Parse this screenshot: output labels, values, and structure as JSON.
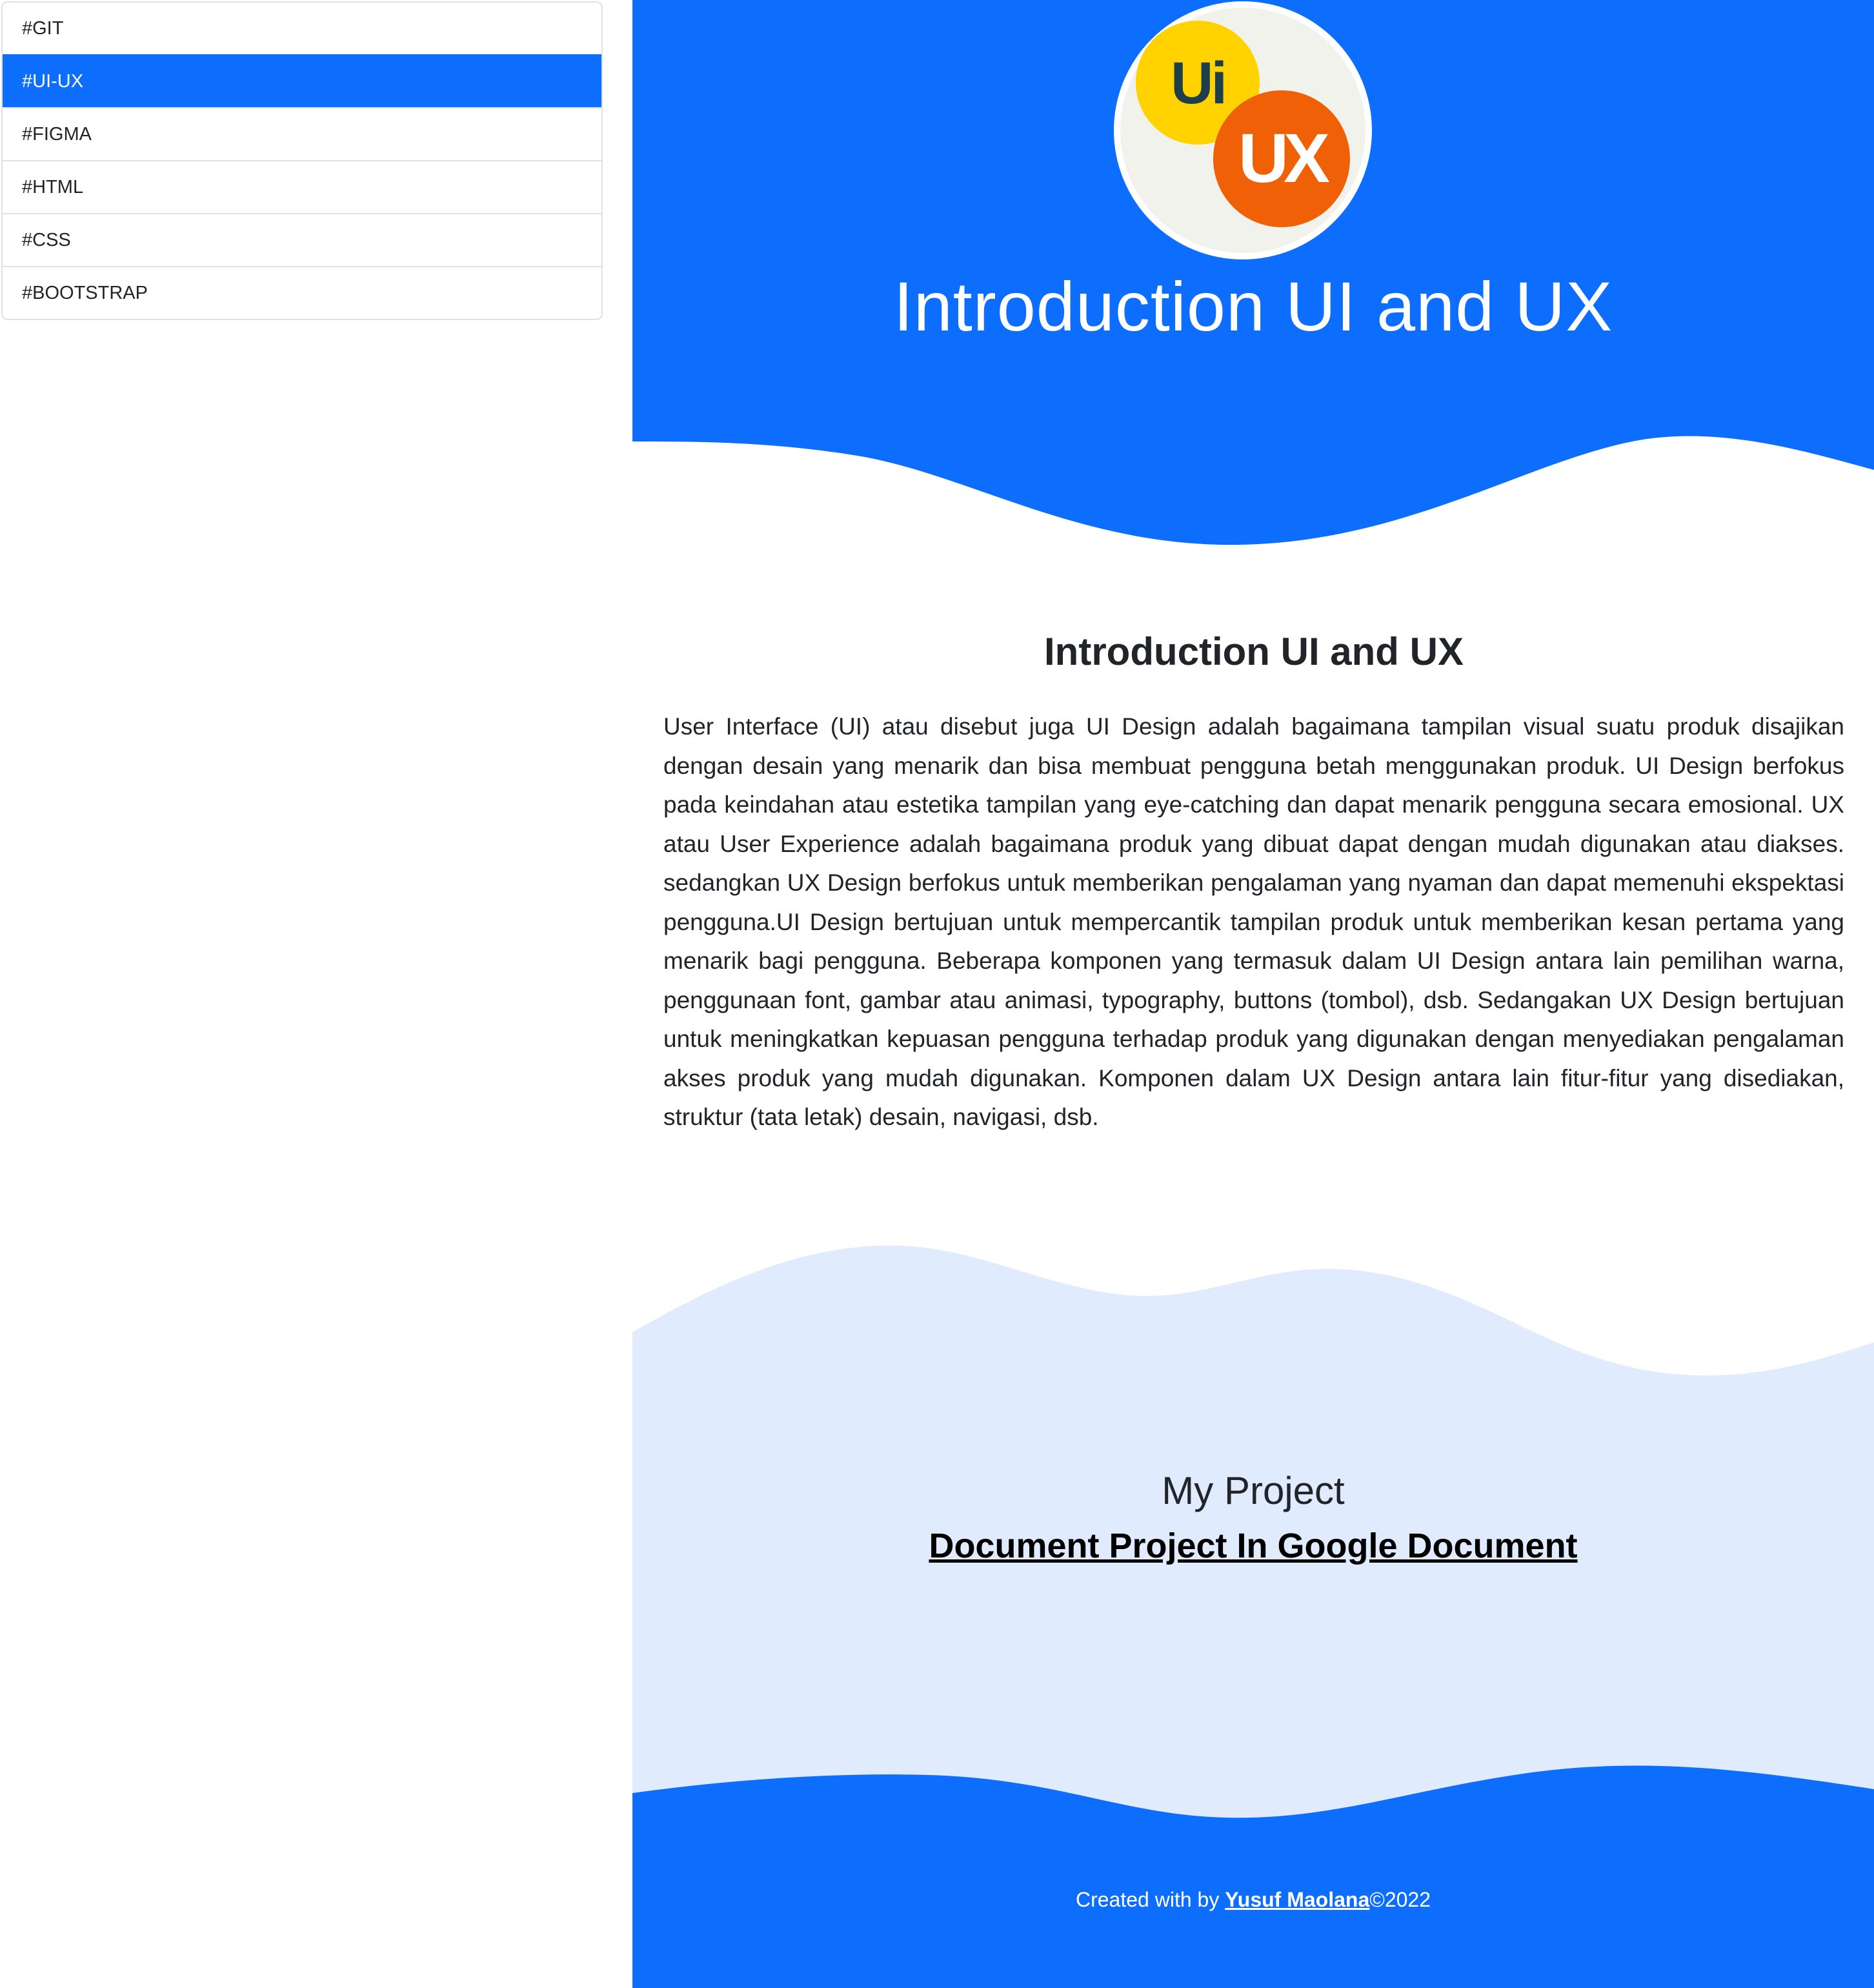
{
  "sidebar": {
    "items": [
      {
        "label": "#GIT",
        "active": false
      },
      {
        "label": "#UI-UX",
        "active": true
      },
      {
        "label": "#FIGMA",
        "active": false
      },
      {
        "label": "#HTML",
        "active": false
      },
      {
        "label": "#CSS",
        "active": false
      },
      {
        "label": "#BOOTSTRAP",
        "active": false
      }
    ]
  },
  "hero": {
    "logo_ui": "Ui",
    "logo_ux": "UX",
    "title": "Introduction UI and UX"
  },
  "intro": {
    "title": "Introduction UI and UX",
    "text": "User Interface (UI) atau disebut juga UI Design adalah bagaimana tampilan visual suatu produk disajikan dengan desain yang menarik dan bisa membuat pengguna betah menggunakan produk. UI Design berfokus pada keindahan atau estetika tampilan yang eye-catching dan dapat menarik pengguna secara emosional. UX atau User Experience adalah bagaimana produk yang dibuat dapat dengan mudah digunakan atau diakses. sedangkan UX Design berfokus untuk memberikan pengalaman yang nyaman dan dapat memenuhi ekspektasi pengguna.UI Design bertujuan untuk mempercantik tampilan produk untuk memberikan kesan pertama yang menarik bagi pengguna. Beberapa komponen yang termasuk dalam UI Design antara lain pemilihan warna, penggunaan font, gambar atau animasi, typography, buttons (tombol), dsb. Sedangakan UX Design bertujuan untuk meningkatkan kepuasan pengguna terhadap produk yang digunakan dengan menyediakan pengalaman akses produk yang mudah digunakan. Komponen dalam UX Design antara lain fitur-fitur yang disediakan, struktur (tata letak) desain, navigasi, dsb."
  },
  "project": {
    "title": "My Project",
    "link_label": "Document Project In Google Document"
  },
  "footer": {
    "prefix": "Created with by ",
    "author": "Yusuf Maolana",
    "suffix": "©2022"
  },
  "colors": {
    "primary": "#0d6efd",
    "light_blue": "#e0ebfe",
    "logo_yellow": "#ffd200",
    "logo_orange": "#f06006",
    "logo_bg": "#f1f2ec"
  }
}
